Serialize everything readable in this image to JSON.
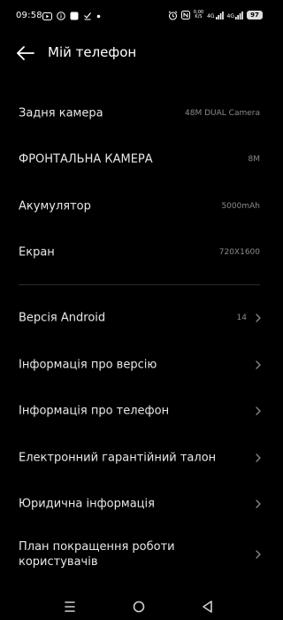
{
  "status_bar": {
    "time": "09:58",
    "net_speed_value": "0,00",
    "net_speed_unit": "K/S",
    "signal_1_label": "4G",
    "signal_2_label": "4G",
    "battery": "97"
  },
  "header": {
    "title": "Мій телефон"
  },
  "specs": [
    {
      "label": "Задня камера",
      "value": "48M DUAL Camera"
    },
    {
      "label": "ФРОНТАЛЬНА КАМЕРА",
      "value": "8M"
    },
    {
      "label": "Акумулятор",
      "value": "5000mAh"
    },
    {
      "label": "Екран",
      "value": "720X1600"
    }
  ],
  "links": [
    {
      "label": "Версія Android",
      "value": "14"
    },
    {
      "label": "Інформація про версію",
      "value": ""
    },
    {
      "label": "Інформація про телефон",
      "value": ""
    },
    {
      "label": "Електронний гарантійний талон",
      "value": ""
    },
    {
      "label": "Юридична інформація",
      "value": ""
    },
    {
      "label": "План покращення роботи користувачів",
      "value": ""
    }
  ],
  "icons": {
    "back": "arrow-left-icon",
    "chevron": "chevron-right-icon",
    "nav_menu": "menu-icon",
    "nav_home": "circle-home-icon",
    "nav_back": "triangle-back-icon"
  }
}
